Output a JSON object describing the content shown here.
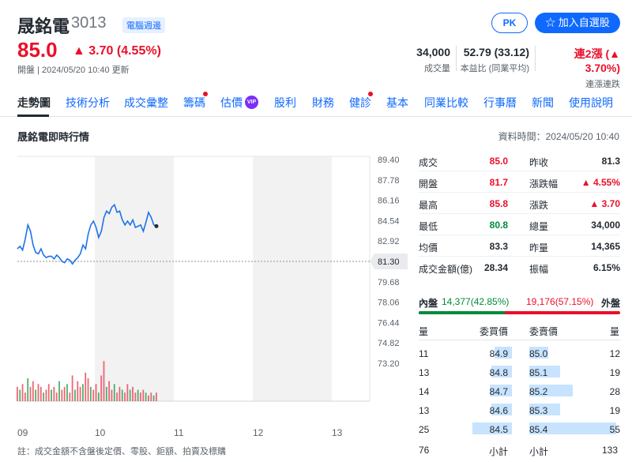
{
  "header": {
    "name": "晟銘電",
    "code": "3013",
    "tag": "電腦週邊",
    "price": "85.0",
    "change": "▲ 3.70 (4.55%)",
    "open_time": "開盤 | 2024/05/20 10:40 更新",
    "pk_label": "PK",
    "add_label": "☆ 加入自選股"
  },
  "stats": [
    {
      "value": "34,000",
      "label": "成交量"
    },
    {
      "value": "52.79 (33.12)",
      "label": "本益比 (同業平均)"
    },
    {
      "value": "連2漲 (▲ 3.70%)",
      "label": "連漲連跌"
    }
  ],
  "nav": [
    "走勢圖",
    "技術分析",
    "成交彙整",
    "籌碼",
    "估價",
    "股利",
    "財務",
    "健診",
    "基本",
    "同業比較",
    "行事曆",
    "新聞",
    "使用說明"
  ],
  "section_title": "晟銘電即時行情",
  "data_time": "資料時間：2024/05/20 10:40",
  "chart_data": {
    "type": "line",
    "x_ticks": [
      "09",
      "10",
      "11",
      "12",
      "13"
    ],
    "y_ticks": [
      "89.40",
      "87.78",
      "86.16",
      "84.54",
      "82.92",
      "81.30",
      "79.68",
      "78.06",
      "76.44",
      "74.82",
      "73.20"
    ],
    "ylim": [
      73.2,
      89.4
    ],
    "reference": "81.30",
    "series": [
      {
        "values": [
          82.3,
          82.5,
          82.2,
          83.1,
          84.2,
          83.7,
          82.6,
          82.0,
          81.9,
          82.3,
          81.8,
          81.6,
          81.7,
          81.7,
          81.5,
          81.8,
          81.6,
          81.3,
          81.2,
          81.5,
          81.4,
          81.1,
          81.4,
          81.6,
          81.9,
          82.6,
          82.3,
          83.5,
          84.2,
          84.5,
          84.0,
          83.2,
          83.7,
          84.8,
          85.3,
          85.1,
          85.6,
          85.8,
          85.2,
          85.3,
          84.6,
          84.2,
          84.5,
          84.2,
          84.6,
          84.0,
          84.1,
          84.2,
          83.7,
          84.4,
          85.2,
          84.8,
          84.2,
          84.1
        ]
      }
    ],
    "volume": [
      5,
      4,
      6,
      3,
      8,
      5,
      7,
      4,
      6,
      5,
      3,
      4,
      6,
      4,
      5,
      3,
      7,
      4,
      5,
      6,
      3,
      9,
      4,
      7,
      5,
      6,
      10,
      8,
      5,
      4,
      6,
      3,
      9,
      14,
      5,
      7,
      4,
      6,
      3,
      5,
      4,
      3,
      6,
      4,
      5,
      3,
      4,
      3,
      4,
      3,
      2,
      3,
      2,
      3
    ]
  },
  "quote": [
    {
      "l1": "成交",
      "v1": "85.0",
      "c1": "red",
      "l2": "昨收",
      "v2": "81.3",
      "c2": ""
    },
    {
      "l1": "開盤",
      "v1": "81.7",
      "c1": "red",
      "l2": "漲跌幅",
      "v2": "▲ 4.55%",
      "c2": "red"
    },
    {
      "l1": "最高",
      "v1": "85.8",
      "c1": "red",
      "l2": "漲跌",
      "v2": "▲ 3.70",
      "c2": "red"
    },
    {
      "l1": "最低",
      "v1": "80.8",
      "c1": "green",
      "l2": "總量",
      "v2": "34,000",
      "c2": ""
    },
    {
      "l1": "均價",
      "v1": "83.3",
      "c1": "",
      "l2": "昨量",
      "v2": "14,365",
      "c2": ""
    },
    {
      "l1": "成交金額(億)",
      "v1": "28.34",
      "c1": "",
      "l2": "振幅",
      "v2": "6.15%",
      "c2": ""
    }
  ],
  "inout": {
    "in_label": "內盤",
    "in_value": "14,377(42.85%)",
    "out_value": "19,176(57.15%)",
    "out_label": "外盤",
    "in_ratio": 0.4285
  },
  "order_header": [
    "量",
    "委買價",
    "委賣價",
    "量"
  ],
  "orders": [
    {
      "bv": "11",
      "bp": "84.9",
      "ap": "85.0",
      "av": "12",
      "bw": 0.2,
      "aw": 0.22
    },
    {
      "bv": "13",
      "bp": "84.8",
      "ap": "85.1",
      "av": "19",
      "bw": 0.24,
      "aw": 0.35
    },
    {
      "bv": "14",
      "bp": "84.7",
      "ap": "85.2",
      "av": "28",
      "bw": 0.25,
      "aw": 0.5
    },
    {
      "bv": "13",
      "bp": "84.6",
      "ap": "85.3",
      "av": "19",
      "bw": 0.24,
      "aw": 0.35
    },
    {
      "bv": "25",
      "bp": "84.5",
      "ap": "85.4",
      "av": "55",
      "bw": 0.45,
      "aw": 1.0
    }
  ],
  "totals": {
    "bid_total": "76",
    "bid_label": "小計",
    "ask_label": "小計",
    "ask_total": "133"
  },
  "note": "註：成交金額不含盤後定價、零股、鉅額、拍賣及標購"
}
